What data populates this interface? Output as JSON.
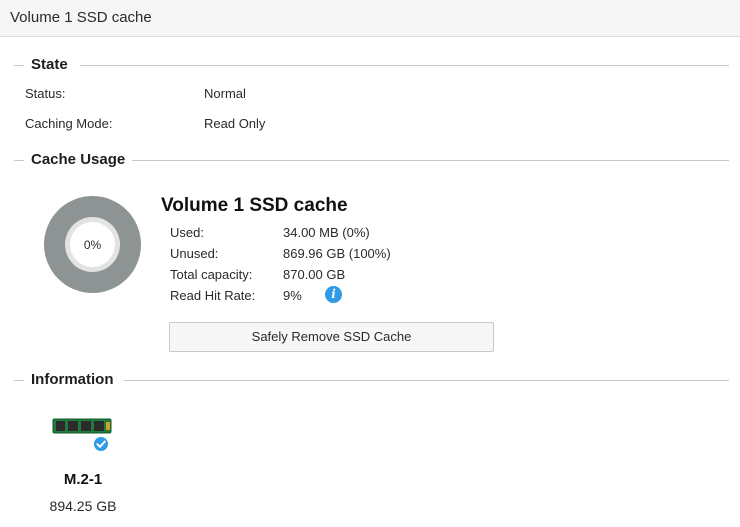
{
  "window": {
    "title": "Volume 1 SSD cache"
  },
  "state": {
    "heading": "State",
    "rows": [
      {
        "label": "Status:",
        "value": "Normal"
      },
      {
        "label": "Caching Mode:",
        "value": "Read Only"
      }
    ]
  },
  "cache_usage": {
    "heading": "Cache Usage",
    "donut_label": "0%",
    "used_fraction": 0,
    "title": "Volume 1 SSD cache",
    "rows": [
      {
        "label": "Used:",
        "value": "34.00 MB (0%)"
      },
      {
        "label": "Unused:",
        "value": "869.96 GB (100%)"
      },
      {
        "label": "Total capacity:",
        "value": "870.00 GB"
      },
      {
        "label": "Read Hit Rate:",
        "value": "9%"
      }
    ],
    "info_icon": "info-icon",
    "button_label": "Safely Remove SSD Cache"
  },
  "information": {
    "heading": "Information",
    "drive": {
      "name": "M.2-1",
      "size": "894.25 GB",
      "icon": "m2-ssd-icon",
      "status_icon": "checkmark-icon"
    }
  },
  "colors": {
    "accent": "#2d9be8",
    "donut_used": "#8e9394",
    "donut_free": "#e3e3e3"
  }
}
